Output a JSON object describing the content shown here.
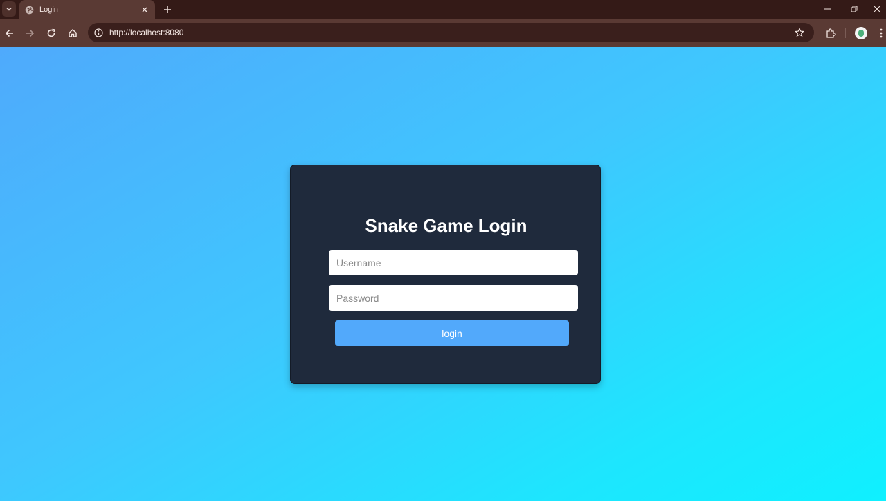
{
  "browser": {
    "tab": {
      "title": "Login"
    },
    "url": "http://localhost:8080"
  },
  "page": {
    "title": "Snake Game Login",
    "username": {
      "placeholder": "Username",
      "value": ""
    },
    "password": {
      "placeholder": "Password",
      "value": ""
    },
    "login_label": "login"
  },
  "colors": {
    "card_background": "#1f2a3c",
    "button_background": "#52a9fb",
    "gradient_start": "#4faafc",
    "gradient_end": "#0ff0ff"
  }
}
